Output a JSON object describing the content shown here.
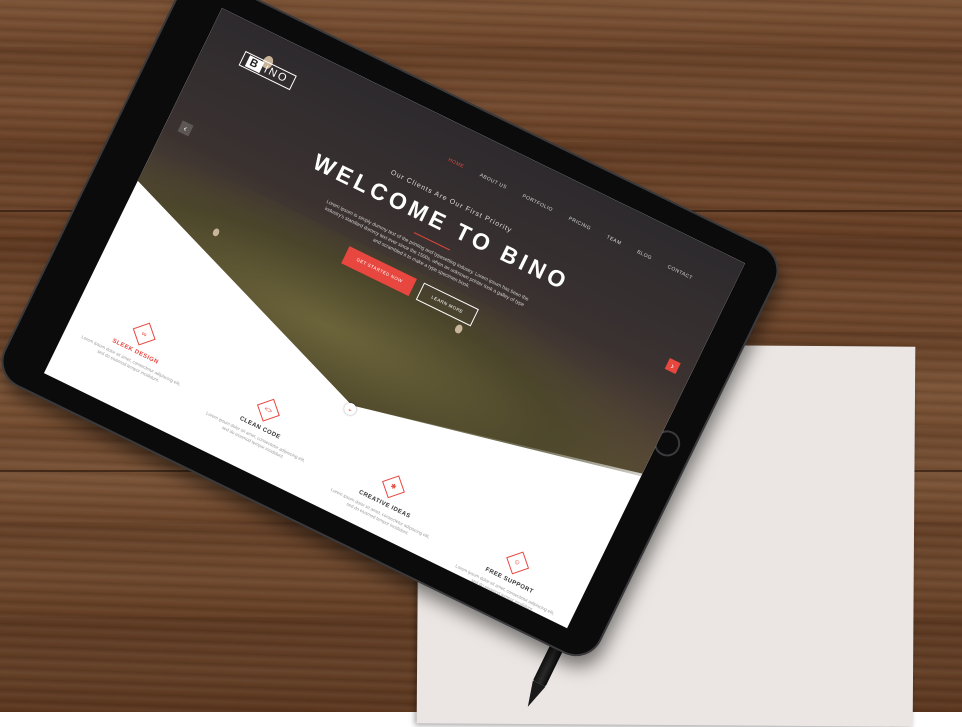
{
  "site": {
    "logo_letter": "B",
    "logo_text": "INO",
    "nav": [
      "HOME",
      "ABOUT US",
      "PORTFOLIO",
      "PRICING",
      "TEAM",
      "BLOG",
      "CONTACT"
    ],
    "tagline": "Our Clients Are Our First Priority",
    "headline": "WELCOME TO BINO",
    "description": "Lorem ipsum is simply dummy text of the printing and typesetting industry. Lorem ipsum has been the industry's standard dummy text ever since the 1500s, when an unknown printer took a galley of type and scrambled it to make a type specimen book.",
    "primary_button": "GET STARTED NOW",
    "secondary_button": "LEARN MORE",
    "features": [
      {
        "title": "SLEEK DESIGN",
        "icon": "infinity-icon",
        "text": "Lorem ipsum dolor sit amet, consectetur adipiscing elit, sed do eiusmod tempor incididunt."
      },
      {
        "title": "CLEAN CODE",
        "icon": "code-icon",
        "text": "Lorem ipsum dolor sit amet, consectetur adipiscing elit, sed do eiusmod tempor incididunt."
      },
      {
        "title": "CREATIVE IDEAS",
        "icon": "bulb-icon",
        "text": "Lorem ipsum dolor sit amet, consectetur adipiscing elit, sed do eiusmod tempor incididunt."
      },
      {
        "title": "FREE SUPPORT",
        "icon": "support-icon",
        "text": "Lorem ipsum dolor sit amet, consectetur adipiscing elit, sed do eiusmod tempor incididunt."
      }
    ]
  },
  "colors": {
    "accent": "#e8473f",
    "wood": "#6a4228",
    "paper": "#ebe6e3"
  }
}
